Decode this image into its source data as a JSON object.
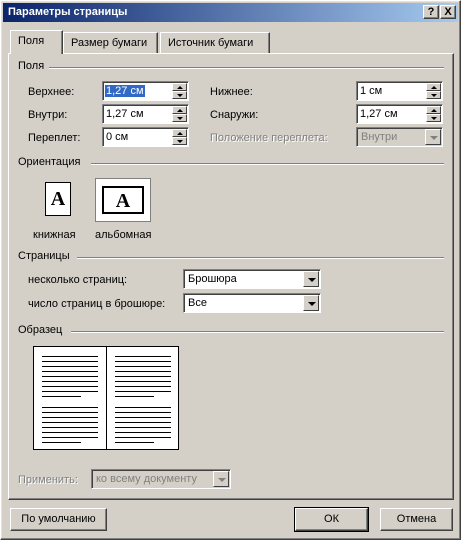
{
  "window": {
    "title": "Параметры страницы",
    "help_button": "?",
    "close_button": "X"
  },
  "tabs": [
    {
      "label": "Поля",
      "active": true
    },
    {
      "label": "Размер бумаги",
      "active": false
    },
    {
      "label": "Источник бумаги",
      "active": false
    }
  ],
  "margins": {
    "group_label": "Поля",
    "top_label": "Верхнее:",
    "top_value": "1,27 см",
    "bottom_label": "Нижнее:",
    "bottom_value": "1 см",
    "inside_label": "Внутри:",
    "inside_value": "1,27 см",
    "outside_label": "Снаружи:",
    "outside_value": "1,27 см",
    "gutter_label": "Переплет:",
    "gutter_value": "0 см",
    "gutter_pos_label": "Положение переплета:",
    "gutter_pos_value": "Внутри"
  },
  "orientation": {
    "group_label": "Ориентация",
    "portrait_label": "книжная",
    "landscape_label": "альбомная",
    "page_letter": "A",
    "selected": "landscape"
  },
  "pages": {
    "group_label": "Страницы",
    "multiple_label": "несколько страниц:",
    "multiple_value": "Брошюра",
    "sheets_label": "число страниц в брошюре:",
    "sheets_value": "Все"
  },
  "preview": {
    "group_label": "Образец"
  },
  "apply": {
    "label": "Применить:",
    "value": "ко всему документу"
  },
  "buttons": {
    "default": "По умолчанию",
    "ok": "ОК",
    "cancel": "Отмена"
  },
  "colors": {
    "dialog_bg": "#d4d0c8",
    "title_bar_start": "#0a246a",
    "title_bar_end": "#a6caf0",
    "selection": "#316ac5"
  },
  "icons": [
    "help-icon",
    "close-icon",
    "portrait-page-icon",
    "landscape-page-icon",
    "dropdown-arrow-icon",
    "spin-up-icon",
    "spin-down-icon"
  ]
}
